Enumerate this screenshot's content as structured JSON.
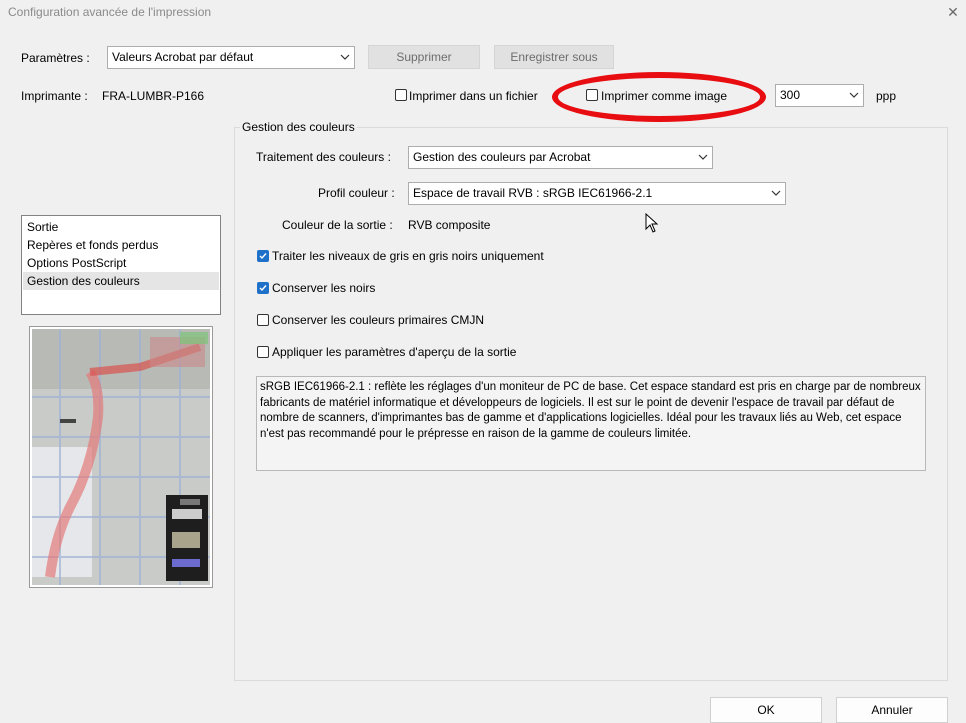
{
  "window": {
    "title": "Configuration avancée de l'impression",
    "close_glyph": "✕"
  },
  "params": {
    "label": "Paramètres :",
    "preset_value": "Valeurs Acrobat par défaut",
    "delete_label": "Supprimer",
    "save_as_label": "Enregistrer sous"
  },
  "printer": {
    "label": "Imprimante :",
    "name": "FRA-LUMBR-P166",
    "print_to_file_label": "Imprimer dans un fichier",
    "print_to_file_checked": false,
    "print_as_image_label": "Imprimer comme image",
    "print_as_image_checked": false,
    "dpi_value": "300",
    "dpi_unit": "ppp"
  },
  "sidebar": {
    "items": [
      {
        "label": "Sortie",
        "selected": false
      },
      {
        "label": "Repères et fonds perdus",
        "selected": false
      },
      {
        "label": "Options PostScript",
        "selected": false
      },
      {
        "label": "Gestion des couleurs",
        "selected": true
      }
    ]
  },
  "color_management": {
    "group_title": "Gestion des couleurs",
    "handling_label": "Traitement des couleurs :",
    "handling_value": "Gestion des couleurs par Acrobat",
    "profile_label": "Profil couleur :",
    "profile_value": "Espace de travail RVB : sRGB IEC61966-2.1",
    "output_color_label": "Couleur de la sortie :",
    "output_color_value": "RVB composite",
    "options": [
      {
        "label": "Traiter les niveaux de gris en gris noirs uniquement",
        "checked": true
      },
      {
        "label": "Conserver les noirs",
        "checked": true
      },
      {
        "label": "Conserver les couleurs primaires CMJN",
        "checked": false
      },
      {
        "label": "Appliquer les paramètres d'aperçu de la sortie",
        "checked": false
      }
    ],
    "description": "sRGB IEC61966-2.1 : reflète les réglages d'un moniteur de PC de base. Cet espace standard est pris en charge par de nombreux fabricants de matériel informatique et développeurs de logiciels. Il est sur le point de devenir l'espace de travail par défaut de nombre de scanners, d'imprimantes bas de gamme et d'applications logicielles. Idéal pour les travaux liés au Web, cet espace n'est pas recommandé pour le prépresse en raison de la gamme de couleurs limitée."
  },
  "footer": {
    "ok_label": "OK",
    "cancel_label": "Annuler"
  },
  "colors": {
    "accent": "#1e70c8",
    "annotation": "#e80d10"
  }
}
